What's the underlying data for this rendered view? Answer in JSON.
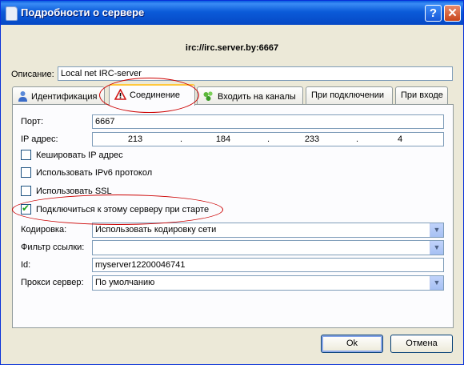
{
  "window": {
    "title": "Подробности о сервере"
  },
  "header": {
    "server": "irc://irc.server.by:6667"
  },
  "description": {
    "label": "Описание:",
    "value": "Local net IRC-server"
  },
  "tabs": [
    {
      "label": "Идентификация",
      "icon": "person-icon"
    },
    {
      "label": "Соединение",
      "icon": "warning-icon"
    },
    {
      "label": "Входить на каналы",
      "icon": "channels-icon"
    },
    {
      "label": "При подключении"
    },
    {
      "label": "При входе"
    }
  ],
  "connection": {
    "port_label": "Порт:",
    "port_value": "6667",
    "ip_label": "IP адрес:",
    "ip_octets": [
      "213",
      "184",
      "233",
      "4"
    ],
    "checkboxes": [
      {
        "label": "Кешировать IP адрес",
        "checked": false
      },
      {
        "label": "Использовать IPv6 протокол",
        "checked": false
      },
      {
        "label": "Использовать SSL",
        "checked": false
      },
      {
        "label": "Подключиться к этому серверу при старте",
        "checked": true
      }
    ],
    "encoding_label": "Кодировка:",
    "encoding_value": "Использовать кодировку сети",
    "link_filter_label": "Фильтр ссылки:",
    "link_filter_value": "",
    "id_label": "Id:",
    "id_value": "myserver12200046741",
    "proxy_label": "Прокси сервер:",
    "proxy_value": "По умолчанию"
  },
  "buttons": {
    "ok": "Ok",
    "cancel": "Отмена"
  },
  "colors": {
    "titlebar": "#0b5bd9",
    "annotation": "#cc0000",
    "active_tab_accent": "#ffc83c"
  }
}
